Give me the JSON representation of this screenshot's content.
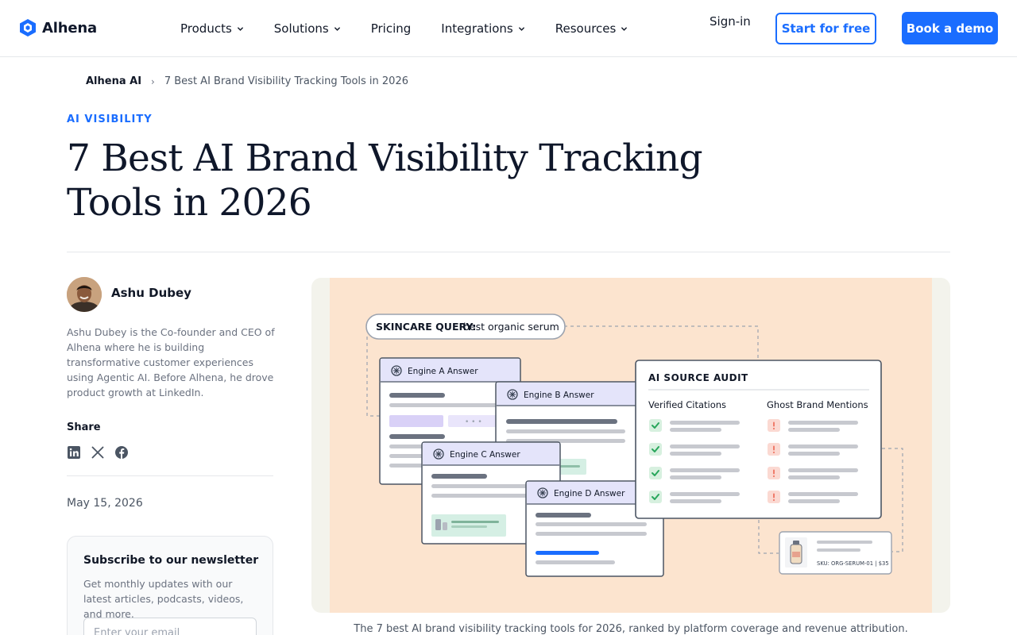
{
  "header": {
    "brand": "Alhena",
    "nav": [
      {
        "label": "Products",
        "has_dropdown": true
      },
      {
        "label": "Solutions",
        "has_dropdown": true
      },
      {
        "label": "Pricing",
        "has_dropdown": false
      },
      {
        "label": "Integrations",
        "has_dropdown": true
      },
      {
        "label": "Resources",
        "has_dropdown": true
      }
    ],
    "signin_label": "Sign-in",
    "start_free_label": "Start for free",
    "book_demo_label": "Book a demo"
  },
  "breadcrumb": {
    "home": "Alhena AI",
    "separator": "›",
    "current": "7 Best AI Brand Visibility Tracking Tools in 2026"
  },
  "article": {
    "category": "AI VISIBILITY",
    "title": "7 Best AI Brand Visibility Tracking Tools in 2026",
    "date": "May 15, 2026",
    "caption": "The 7 best AI brand visibility tracking tools for 2026, ranked by platform coverage and revenue attribution."
  },
  "author": {
    "name": "Ashu Dubey",
    "bio": "Ashu Dubey is the Co-founder and CEO of Alhena where he is building transformative customer experiences using Agentic AI. Before Alhena, he drove product growth at LinkedIn."
  },
  "share": {
    "label": "Share",
    "icons": [
      "linkedin-icon",
      "x-icon",
      "facebook-icon"
    ]
  },
  "newsletter": {
    "title": "Subscribe to our newsletter",
    "description": "Get monthly updates with our latest articles, podcasts, videos, and more.",
    "email_placeholder": "Enter your email"
  },
  "illustration": {
    "query_label": "SKINCARE QUERY:",
    "query_text": "best organic serum",
    "engine_a": "Engine A Answer",
    "engine_b": "Engine B Answer",
    "engine_c": "Engine C Answer",
    "engine_d": "Engine D Answer",
    "audit_title": "AI SOURCE AUDIT",
    "verified_label": "Verified Citations",
    "ghost_label": "Ghost Brand Mentions",
    "sku_text": "SKU: ORG-SERUM-01 | $35",
    "ellipsis": "• • •"
  },
  "colors": {
    "accent": "#1a6dff",
    "hero_bg": "#fce4cf",
    "engine_header": "#e4e4fa",
    "verified": "#28a65b",
    "ghost": "#f07b6a"
  }
}
